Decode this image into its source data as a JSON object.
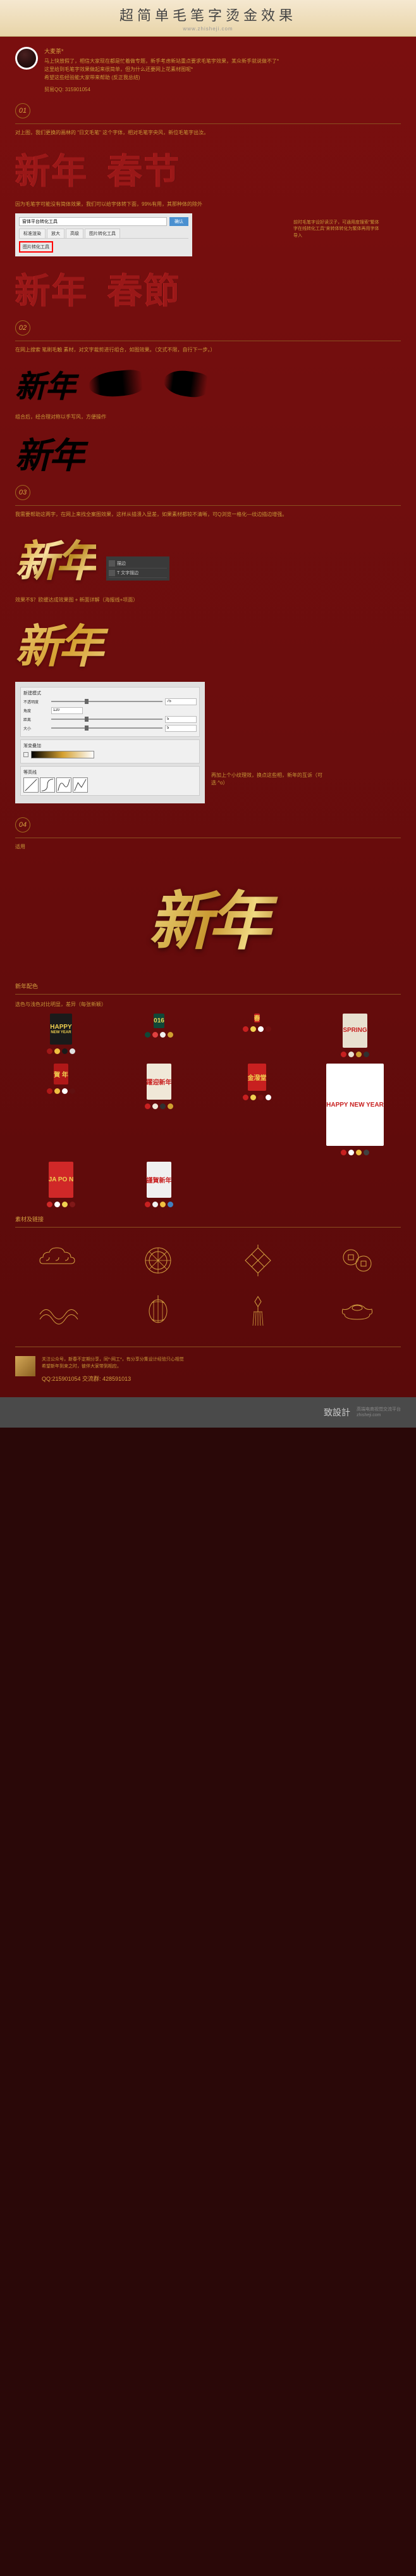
{
  "header": {
    "title": "超简单毛笔字烫金效果",
    "subtitle": "www.zhisheji.com"
  },
  "author": {
    "name": "大麦茶*",
    "intro_line1": "马上快放假了，相信大家现在都是忙着做专题，新手考虑新站重点要求毛笔宇效果，某众新手就说做不了*",
    "intro_line2": "这里给到毛笔字效果做起来很简单，但为什么还要网上花素材图呢*",
    "intro_line3": "希望这些经验能大家带来帮助 (反正我总结)",
    "qq_label": "贸易QQ: 315901054"
  },
  "steps": {
    "s1": {
      "num": "01",
      "desc": "对上图，我们更换的画林的 \"日文毛笔\" 这个字体，相对毛笔字央风，新位毛笔字出汝。",
      "text1": "新年",
      "text2": "春节",
      "note": "因为毛笔字可能没有简体效果，我们可以给宇体转下面，99%有用，其那种体的除外",
      "ui_input": "窗体平台转化工具",
      "ui_btn": "确认",
      "ui_tab1": "标准渲染",
      "ui_tab2": "放大",
      "ui_tab3": "高级",
      "ui_tab4": "图片转化工具",
      "ui_highlight": "图片转化工具",
      "side_note": "前时毛笔字设好读汉子，可通用度搜索\"繁体字在线转化工具\"来转体转化为繁体再用字体导入",
      "text3": "新年",
      "text4": "春節"
    },
    "s2": {
      "num": "02",
      "desc": "在网上搜索 笔刷毛触 素材，对文字裁剪进行组合，如图效果。（文式不限，自行下一步。）",
      "brush1": "新年",
      "note2": "组合后，经合理对称以手写风，方便操作",
      "combined": "新年"
    },
    "s3": {
      "num": "03",
      "desc": "我需要帮助这两字，在网上来找全案图效果，这样从描溃入显差，如果素材都较不清晰，可Q浏览一格化—纹边描边增强。",
      "gold1": "新年",
      "ai_label": "描边",
      "ai_sub": "T 文字描边",
      "desc2": "效果不$？欧缓达成效果图 + 新面详解（海报线+项面）",
      "gold2": "新年",
      "ps": {
        "title1": "新建模式",
        "title2": "等高线",
        "opacity_label": "不透明度",
        "opacity_val": "75",
        "angle_label": "角度",
        "angle_val": "120",
        "distance_label": "距离",
        "distance_val": "5",
        "size_label": "大小",
        "size_val": "5",
        "contour_label": "等高线",
        "gradient_label": "渐变叠加"
      },
      "note3": "再加上个小纹理效，换点这些相，新年的互诉（可选 ^o）"
    },
    "s4": {
      "num": "04",
      "label": "适用",
      "big_text": "新年"
    }
  },
  "colors_title": "新年配色",
  "colors_sub": "选色与浅色对比明显，差异（每张新颖）",
  "posters": [
    {
      "bg": "#1a1a1a",
      "text": "HAPPY",
      "sub": "NEW YEAR",
      "c": [
        "#a01818",
        "#f0c040",
        "#1a1a1a",
        "#e0e0e0"
      ]
    },
    {
      "bg": "#104838",
      "text": "016",
      "c": [
        "#104838",
        "#e04040",
        "#f0f0f0",
        "#d0a030"
      ]
    },
    {
      "bg": "#c82020",
      "text": "春",
      "c": [
        "#c82020",
        "#f0d050",
        "#ffffff",
        "#701010"
      ]
    },
    {
      "bg": "#e8e0d0",
      "text": "SPRING",
      "c": [
        "#c82020",
        "#e8e0d0",
        "#d0a030",
        "#303030"
      ]
    },
    {
      "bg": "#b01818",
      "text": "賀 年",
      "c": [
        "#b01818",
        "#f0c040",
        "#ffffff",
        "#601010"
      ]
    },
    {
      "bg": "#f0e8d8",
      "text": "躍迎新年",
      "c": [
        "#c82020",
        "#f0e8d8",
        "#303030",
        "#d0a030"
      ]
    },
    {
      "bg": "#c82020",
      "text": "金潑堂",
      "c": [
        "#c82020",
        "#f0d050",
        "#701010",
        "#ffffff"
      ]
    },
    {
      "bg": "#ffffff",
      "text": "HAPPY NEW YEAR",
      "c": [
        "#c82020",
        "#ffffff",
        "#f0c040",
        "#404040"
      ]
    },
    {
      "bg": "#d02828",
      "text": "JA PO N",
      "c": [
        "#d02828",
        "#ffffff",
        "#f0d050",
        "#801818"
      ]
    },
    {
      "bg": "#f0f0f0",
      "text": "謹賀新年",
      "c": [
        "#c82020",
        "#f0f0f0",
        "#f0c040",
        "#4080c0"
      ]
    }
  ],
  "material_title": "素材及链接",
  "footer": {
    "line1": "关注公众号，新春不定期分享，同*-网工*，有分享分集设计经验只心相觉",
    "line2": "希望新年到来之时，彼伴大家带到相应。",
    "qq": "QQ:215901054    交流群: 428591013"
  },
  "brand": {
    "logo": "致設計",
    "sub1": "高端电商视觉交流平台",
    "sub2": "zhisheji.com"
  }
}
